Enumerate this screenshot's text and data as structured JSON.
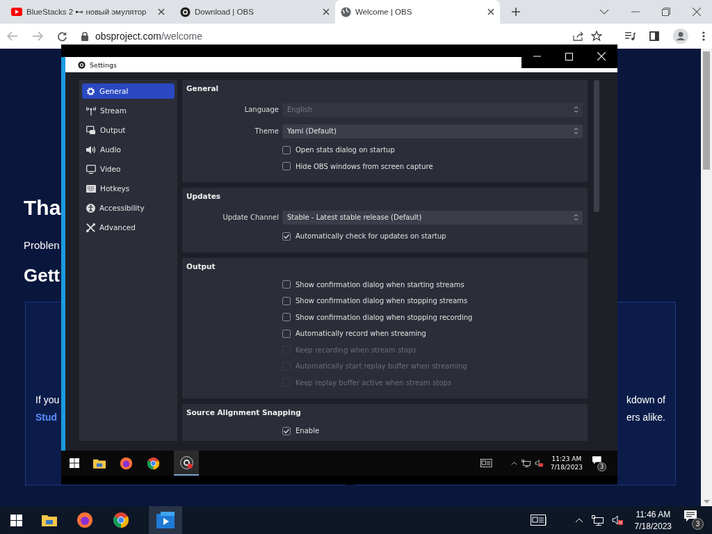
{
  "browser": {
    "tabs": [
      {
        "title": "BlueStacks 2 ⊷ новый эмулятор",
        "selected": false
      },
      {
        "title": "Download | OBS",
        "selected": false
      },
      {
        "title": "Welcome | OBS",
        "selected": true
      }
    ],
    "url_host": "obsproject.com",
    "url_path": "/welcome"
  },
  "page": {
    "heading": "Tha",
    "text": "Problen",
    "subheading": "Gett",
    "card_left": {
      "line": "If you",
      "link": "Stud"
    },
    "card_right": {
      "line_1": "kdown of",
      "line_2": "ers alike."
    }
  },
  "vm": {
    "settings": {
      "title": "Settings",
      "sidebar": [
        {
          "label": "General",
          "selected": true
        },
        {
          "label": "Stream",
          "selected": false
        },
        {
          "label": "Output",
          "selected": false
        },
        {
          "label": "Audio",
          "selected": false
        },
        {
          "label": "Video",
          "selected": false
        },
        {
          "label": "Hotkeys",
          "selected": false
        },
        {
          "label": "Accessibility",
          "selected": false
        },
        {
          "label": "Advanced",
          "selected": false
        }
      ],
      "sections": [
        {
          "title": "General",
          "rows": [
            {
              "kind": "select",
              "label": "Language",
              "value": "English",
              "disabled": true
            },
            {
              "kind": "select",
              "label": "Theme",
              "value": "Yami (Default)",
              "disabled": false
            },
            {
              "kind": "checkbox",
              "label": "Open stats dialog on startup",
              "checked": false,
              "disabled": false
            },
            {
              "kind": "checkbox",
              "label": "Hide OBS windows from screen capture",
              "checked": false,
              "disabled": false
            }
          ]
        },
        {
          "title": "Updates",
          "rows": [
            {
              "kind": "select",
              "label": "Update Channel",
              "value": "Stable - Latest stable release (Default)",
              "disabled": false
            },
            {
              "kind": "checkbox",
              "label": "Automatically check for updates on startup",
              "checked": true,
              "disabled": false
            }
          ]
        },
        {
          "title": "Output",
          "rows": [
            {
              "kind": "checkbox",
              "label": "Show confirmation dialog when starting streams",
              "checked": false,
              "disabled": false
            },
            {
              "kind": "checkbox",
              "label": "Show confirmation dialog when stopping streams",
              "checked": false,
              "disabled": false
            },
            {
              "kind": "checkbox",
              "label": "Show confirmation dialog when stopping recording",
              "checked": false,
              "disabled": false
            },
            {
              "kind": "checkbox",
              "label": "Automatically record when streaming",
              "checked": false,
              "disabled": false
            },
            {
              "kind": "checkbox",
              "label": "Keep recording when stream stops",
              "checked": false,
              "disabled": true
            },
            {
              "kind": "checkbox",
              "label": "Automatically start replay buffer when streaming",
              "checked": false,
              "disabled": true
            },
            {
              "kind": "checkbox",
              "label": "Keep replay buffer active when stream stops",
              "checked": false,
              "disabled": true
            }
          ]
        },
        {
          "title": "Source Alignment Snapping",
          "rows": [
            {
              "kind": "checkbox",
              "label": "Enable",
              "checked": true,
              "disabled": false
            }
          ]
        }
      ]
    },
    "taskbar": {
      "time": "11:23 AM",
      "date": "7/18/2023",
      "notifications": "3"
    }
  },
  "taskbar": {
    "time": "11:46 AM",
    "date": "7/18/2023",
    "notifications": "3"
  }
}
